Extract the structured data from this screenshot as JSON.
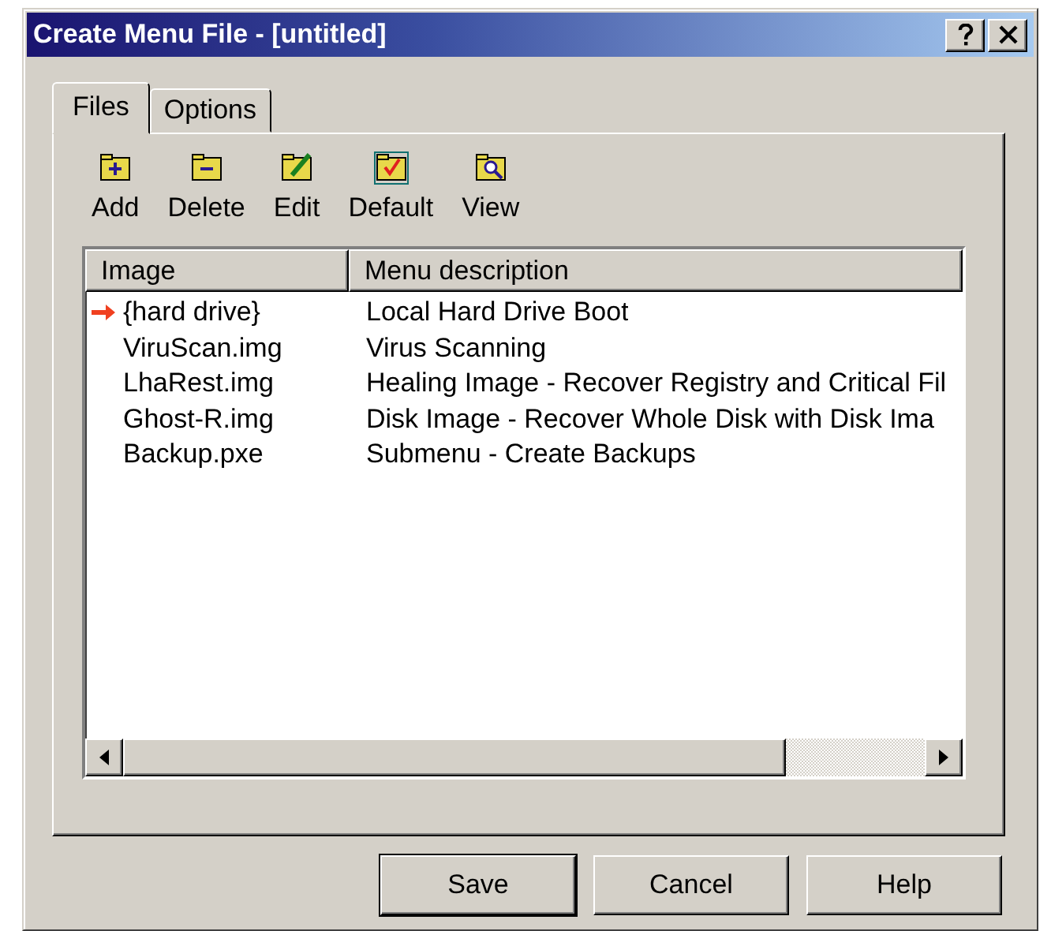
{
  "window": {
    "title": "Create Menu File - [untitled]"
  },
  "tabs": [
    {
      "label": "Files",
      "selected": true
    },
    {
      "label": "Options",
      "selected": false
    }
  ],
  "toolbar": [
    {
      "label": "Add",
      "kind": "add"
    },
    {
      "label": "Delete",
      "kind": "delete"
    },
    {
      "label": "Edit",
      "kind": "edit"
    },
    {
      "label": "Default",
      "kind": "default"
    },
    {
      "label": "View",
      "kind": "view"
    }
  ],
  "table": {
    "columns": [
      "Image",
      "Menu description"
    ],
    "rows": [
      {
        "image": "{hard drive}",
        "description": "Local Hard Drive Boot",
        "default": true
      },
      {
        "image": "ViruScan.img",
        "description": "Virus Scanning",
        "default": false
      },
      {
        "image": "LhaRest.img",
        "description": "Healing Image - Recover Registry and Critical Fil",
        "default": false
      },
      {
        "image": "Ghost-R.img",
        "description": "Disk Image - Recover Whole Disk with Disk Ima",
        "default": false
      },
      {
        "image": "Backup.pxe",
        "description": "Submenu - Create Backups",
        "default": false
      }
    ]
  },
  "buttons": [
    "Save",
    "Cancel",
    "Help"
  ]
}
